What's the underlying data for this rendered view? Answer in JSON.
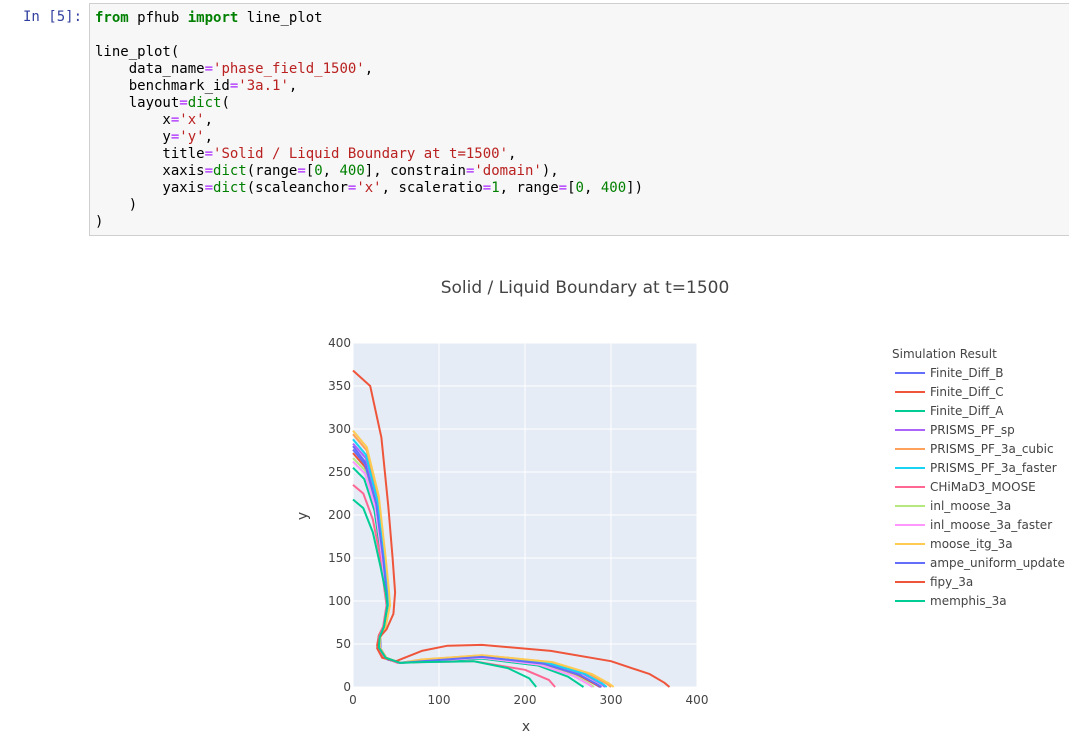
{
  "cell": {
    "prompt": "In [5]:",
    "code_lines": [
      [
        {
          "t": "from",
          "c": "kw"
        },
        {
          "t": " pfhub "
        },
        {
          "t": "import",
          "c": "kw"
        },
        {
          "t": " line_plot"
        }
      ],
      [],
      [
        {
          "t": "line_plot("
        }
      ],
      [
        {
          "t": "    data_name"
        },
        {
          "t": "=",
          "c": "op"
        },
        {
          "t": "'phase_field_1500'",
          "c": "st"
        },
        {
          "t": ","
        }
      ],
      [
        {
          "t": "    benchmark_id"
        },
        {
          "t": "=",
          "c": "op"
        },
        {
          "t": "'3a.1'",
          "c": "st"
        },
        {
          "t": ","
        }
      ],
      [
        {
          "t": "    layout"
        },
        {
          "t": "=",
          "c": "op"
        },
        {
          "t": "dict",
          "c": "bi"
        },
        {
          "t": "("
        }
      ],
      [
        {
          "t": "        x"
        },
        {
          "t": "=",
          "c": "op"
        },
        {
          "t": "'x'",
          "c": "st"
        },
        {
          "t": ","
        }
      ],
      [
        {
          "t": "        y"
        },
        {
          "t": "=",
          "c": "op"
        },
        {
          "t": "'y'",
          "c": "st"
        },
        {
          "t": ","
        }
      ],
      [
        {
          "t": "        title"
        },
        {
          "t": "=",
          "c": "op"
        },
        {
          "t": "'Solid / Liquid Boundary at t=1500'",
          "c": "st"
        },
        {
          "t": ","
        }
      ],
      [
        {
          "t": "        xaxis"
        },
        {
          "t": "=",
          "c": "op"
        },
        {
          "t": "dict",
          "c": "bi"
        },
        {
          "t": "(range"
        },
        {
          "t": "=",
          "c": "op"
        },
        {
          "t": "["
        },
        {
          "t": "0",
          "c": "nm"
        },
        {
          "t": ", "
        },
        {
          "t": "400",
          "c": "nm"
        },
        {
          "t": "], constrain"
        },
        {
          "t": "=",
          "c": "op"
        },
        {
          "t": "'domain'",
          "c": "st"
        },
        {
          "t": "),"
        }
      ],
      [
        {
          "t": "        yaxis"
        },
        {
          "t": "=",
          "c": "op"
        },
        {
          "t": "dict",
          "c": "bi"
        },
        {
          "t": "(scaleanchor"
        },
        {
          "t": "=",
          "c": "op"
        },
        {
          "t": "'x'",
          "c": "st"
        },
        {
          "t": ", scaleratio"
        },
        {
          "t": "=",
          "c": "op"
        },
        {
          "t": "1",
          "c": "nm"
        },
        {
          "t": ", range"
        },
        {
          "t": "=",
          "c": "op"
        },
        {
          "t": "["
        },
        {
          "t": "0",
          "c": "nm"
        },
        {
          "t": ", "
        },
        {
          "t": "400",
          "c": "nm"
        },
        {
          "t": "])"
        }
      ],
      [
        {
          "t": "    )"
        }
      ],
      [
        {
          "t": ")"
        }
      ]
    ]
  },
  "chart_data": {
    "type": "line",
    "title": "Solid / Liquid Boundary at t=1500",
    "xlabel": "x",
    "ylabel": "y",
    "xlim": [
      0,
      400
    ],
    "ylim": [
      0,
      400
    ],
    "xticks": [
      0,
      100,
      200,
      300,
      400
    ],
    "yticks": [
      0,
      50,
      100,
      150,
      200,
      250,
      300,
      350,
      400
    ],
    "grid": true,
    "plot_background": "#E5ECF6",
    "legend": {
      "title": "Simulation Result",
      "placement": "right"
    },
    "series": [
      {
        "name": "Finite_Diff_B",
        "color": "#636EFA",
        "points": [
          [
            0,
            280
          ],
          [
            14,
            262
          ],
          [
            27,
            215
          ],
          [
            35,
            150
          ],
          [
            39,
            110
          ],
          [
            40,
            95
          ],
          [
            36,
            70
          ],
          [
            32,
            58
          ],
          [
            32,
            45
          ],
          [
            40,
            32
          ],
          [
            55,
            28
          ],
          [
            80,
            30
          ],
          [
            150,
            34
          ],
          [
            220,
            26
          ],
          [
            262,
            14
          ],
          [
            282,
            3
          ],
          [
            287,
            0
          ]
        ]
      },
      {
        "name": "Finite_Diff_C",
        "color": "#EF553B",
        "points": [
          [
            0,
            272
          ],
          [
            14,
            256
          ],
          [
            26,
            210
          ],
          [
            34,
            150
          ],
          [
            38,
            110
          ],
          [
            40,
            95
          ],
          [
            36,
            72
          ],
          [
            30,
            60
          ],
          [
            28,
            48
          ],
          [
            35,
            35
          ],
          [
            55,
            28
          ],
          [
            80,
            30
          ],
          [
            150,
            34
          ],
          [
            220,
            27
          ],
          [
            262,
            14
          ],
          [
            282,
            3
          ],
          [
            288,
            0
          ]
        ]
      },
      {
        "name": "Finite_Diff_A",
        "color": "#00CC96",
        "points": [
          [
            0,
            255
          ],
          [
            13,
            242
          ],
          [
            25,
            205
          ],
          [
            33,
            150
          ],
          [
            38,
            110
          ],
          [
            40,
            95
          ],
          [
            36,
            70
          ],
          [
            31,
            58
          ],
          [
            30,
            46
          ],
          [
            38,
            34
          ],
          [
            55,
            28
          ],
          [
            80,
            30
          ],
          [
            150,
            33
          ],
          [
            215,
            25
          ],
          [
            250,
            12
          ],
          [
            265,
            2
          ],
          [
            268,
            0
          ]
        ]
      },
      {
        "name": "PRISMS_PF_sp",
        "color": "#AB63FA",
        "points": [
          [
            0,
            283
          ],
          [
            15,
            266
          ],
          [
            27,
            215
          ],
          [
            35,
            150
          ],
          [
            40,
            110
          ],
          [
            41,
            95
          ],
          [
            37,
            70
          ],
          [
            31,
            58
          ],
          [
            30,
            46
          ],
          [
            38,
            34
          ],
          [
            55,
            28
          ],
          [
            80,
            31
          ],
          [
            150,
            36
          ],
          [
            225,
            28
          ],
          [
            268,
            15
          ],
          [
            288,
            4
          ],
          [
            293,
            0
          ]
        ]
      },
      {
        "name": "PRISMS_PF_3a_cubic",
        "color": "#FFA15A",
        "points": [
          [
            0,
            294
          ],
          [
            16,
            275
          ],
          [
            29,
            220
          ],
          [
            37,
            150
          ],
          [
            41,
            110
          ],
          [
            42,
            95
          ],
          [
            37,
            70
          ],
          [
            31,
            58
          ],
          [
            30,
            46
          ],
          [
            38,
            34
          ],
          [
            55,
            28
          ],
          [
            80,
            32
          ],
          [
            150,
            37
          ],
          [
            230,
            29
          ],
          [
            275,
            15
          ],
          [
            295,
            4
          ],
          [
            300,
            0
          ]
        ]
      },
      {
        "name": "PRISMS_PF_3a_faster",
        "color": "#19D3F3",
        "points": [
          [
            0,
            288
          ],
          [
            15,
            270
          ],
          [
            28,
            218
          ],
          [
            36,
            150
          ],
          [
            40,
            110
          ],
          [
            41,
            95
          ],
          [
            37,
            70
          ],
          [
            31,
            58
          ],
          [
            30,
            46
          ],
          [
            38,
            34
          ],
          [
            55,
            28
          ],
          [
            80,
            31
          ],
          [
            150,
            36
          ],
          [
            226,
            28
          ],
          [
            270,
            15
          ],
          [
            290,
            4
          ],
          [
            295,
            0
          ]
        ]
      },
      {
        "name": "CHiMaD3_MOOSE",
        "color": "#FF6692",
        "points": [
          [
            0,
            235
          ],
          [
            12,
            225
          ],
          [
            23,
            195
          ],
          [
            32,
            150
          ],
          [
            37,
            110
          ],
          [
            39,
            95
          ],
          [
            35,
            70
          ],
          [
            30,
            58
          ],
          [
            29,
            46
          ],
          [
            37,
            34
          ],
          [
            52,
            28
          ],
          [
            78,
            29
          ],
          [
            140,
            30
          ],
          [
            200,
            20
          ],
          [
            228,
            8
          ],
          [
            235,
            0
          ]
        ]
      },
      {
        "name": "inl_moose_3a",
        "color": "#B6E880",
        "points": [
          [
            0,
            266
          ],
          [
            14,
            252
          ],
          [
            26,
            210
          ],
          [
            34,
            150
          ],
          [
            38,
            110
          ],
          [
            40,
            95
          ],
          [
            36,
            70
          ],
          [
            31,
            58
          ],
          [
            30,
            46
          ],
          [
            38,
            34
          ],
          [
            55,
            28
          ],
          [
            80,
            30
          ],
          [
            150,
            34
          ],
          [
            218,
            26
          ],
          [
            258,
            13
          ],
          [
            276,
            3
          ],
          [
            280,
            0
          ]
        ]
      },
      {
        "name": "inl_moose_3a_faster",
        "color": "#FF97FF",
        "points": [
          [
            0,
            262
          ],
          [
            14,
            248
          ],
          [
            26,
            208
          ],
          [
            34,
            150
          ],
          [
            38,
            110
          ],
          [
            40,
            95
          ],
          [
            36,
            70
          ],
          [
            31,
            58
          ],
          [
            30,
            46
          ],
          [
            38,
            34
          ],
          [
            55,
            28
          ],
          [
            80,
            30
          ],
          [
            150,
            34
          ],
          [
            216,
            26
          ],
          [
            256,
            13
          ],
          [
            274,
            3
          ],
          [
            278,
            0
          ]
        ]
      },
      {
        "name": "moose_itg_3a",
        "color": "#FECB52",
        "points": [
          [
            0,
            298
          ],
          [
            16,
            279
          ],
          [
            30,
            222
          ],
          [
            38,
            150
          ],
          [
            42,
            110
          ],
          [
            43,
            95
          ],
          [
            38,
            70
          ],
          [
            32,
            58
          ],
          [
            31,
            46
          ],
          [
            39,
            34
          ],
          [
            56,
            28
          ],
          [
            82,
            32
          ],
          [
            150,
            37
          ],
          [
            232,
            29
          ],
          [
            278,
            15
          ],
          [
            298,
            4
          ],
          [
            303,
            0
          ]
        ]
      },
      {
        "name": "ampe_uniform_update",
        "color": "#636EFA",
        "points": [
          [
            0,
            276
          ],
          [
            14,
            259
          ],
          [
            27,
            213
          ],
          [
            35,
            150
          ],
          [
            39,
            110
          ],
          [
            40,
            95
          ],
          [
            36,
            70
          ],
          [
            31,
            58
          ],
          [
            30,
            46
          ],
          [
            38,
            34
          ],
          [
            55,
            28
          ],
          [
            80,
            30
          ],
          [
            150,
            35
          ],
          [
            222,
            27
          ],
          [
            264,
            14
          ],
          [
            284,
            3
          ],
          [
            289,
            0
          ]
        ]
      },
      {
        "name": "fipy_3a",
        "color": "#EF553B",
        "points": [
          [
            0,
            368
          ],
          [
            20,
            350
          ],
          [
            33,
            290
          ],
          [
            41,
            210
          ],
          [
            46,
            150
          ],
          [
            49,
            110
          ],
          [
            47,
            85
          ],
          [
            39,
            67
          ],
          [
            31,
            58
          ],
          [
            28,
            45
          ],
          [
            34,
            34
          ],
          [
            50,
            30
          ],
          [
            80,
            42
          ],
          [
            110,
            48
          ],
          [
            150,
            49
          ],
          [
            230,
            42
          ],
          [
            300,
            30
          ],
          [
            345,
            15
          ],
          [
            362,
            5
          ],
          [
            368,
            0
          ]
        ]
      },
      {
        "name": "memphis_3a",
        "color": "#00CC96",
        "points": [
          [
            0,
            218
          ],
          [
            12,
            208
          ],
          [
            23,
            180
          ],
          [
            32,
            140
          ],
          [
            38,
            110
          ],
          [
            40,
            95
          ],
          [
            36,
            70
          ],
          [
            31,
            58
          ],
          [
            30,
            46
          ],
          [
            38,
            34
          ],
          [
            55,
            28
          ],
          [
            80,
            29
          ],
          [
            140,
            30
          ],
          [
            180,
            22
          ],
          [
            205,
            10
          ],
          [
            213,
            0
          ]
        ]
      }
    ]
  }
}
